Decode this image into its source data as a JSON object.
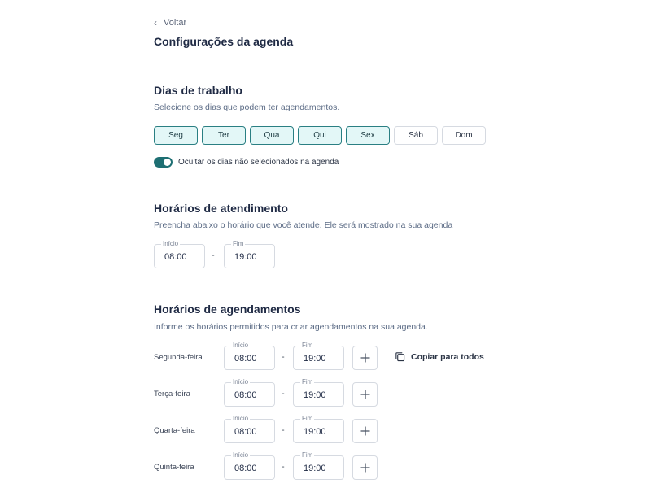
{
  "nav": {
    "back_label": "Voltar",
    "page_title": "Configurações da agenda"
  },
  "work_days": {
    "title": "Dias de trabalho",
    "subtitle": "Selecione os dias que podem ter agendamentos.",
    "days": [
      {
        "label": "Seg",
        "selected": true
      },
      {
        "label": "Ter",
        "selected": true
      },
      {
        "label": "Qua",
        "selected": true
      },
      {
        "label": "Qui",
        "selected": true
      },
      {
        "label": "Sex",
        "selected": true
      },
      {
        "label": "Sáb",
        "selected": false
      },
      {
        "label": "Dom",
        "selected": false
      }
    ],
    "toggle_label": "Ocultar os dias não selecionados na agenda",
    "toggle_on": true
  },
  "service_hours": {
    "title": "Horários de atendimento",
    "subtitle": "Preencha abaixo o horário que você atende. Ele será mostrado na sua agenda",
    "start_label": "Início",
    "start_value": "08:00",
    "separator": "-",
    "end_label": "Fim",
    "end_value": "19:00"
  },
  "booking_hours": {
    "title": "Horários de agendamentos",
    "subtitle": "Informe os horários permitidos para criar agendamentos na sua agenda.",
    "copy_all_label": "Copiar para todos",
    "rows": [
      {
        "day": "Segunda-feira",
        "start_label": "Início",
        "start": "08:00",
        "separator": "-",
        "end_label": "Fim",
        "end": "19:00"
      },
      {
        "day": "Terça-feira",
        "start_label": "Início",
        "start": "08:00",
        "separator": "-",
        "end_label": "Fim",
        "end": "19:00"
      },
      {
        "day": "Quarta-feira",
        "start_label": "Início",
        "start": "08:00",
        "separator": "-",
        "end_label": "Fim",
        "end": "19:00"
      },
      {
        "day": "Quinta-feira",
        "start_label": "Início",
        "start": "08:00",
        "separator": "-",
        "end_label": "Fim",
        "end": "19:00"
      }
    ]
  },
  "icons": {
    "back": "chevron-left-icon",
    "add": "plus-icon",
    "copy": "copy-icon"
  },
  "colors": {
    "accent": "#1e6f73",
    "selected_bg": "#e3f7f7",
    "selected_border": "#2a7f83",
    "border": "#d6dae1"
  }
}
